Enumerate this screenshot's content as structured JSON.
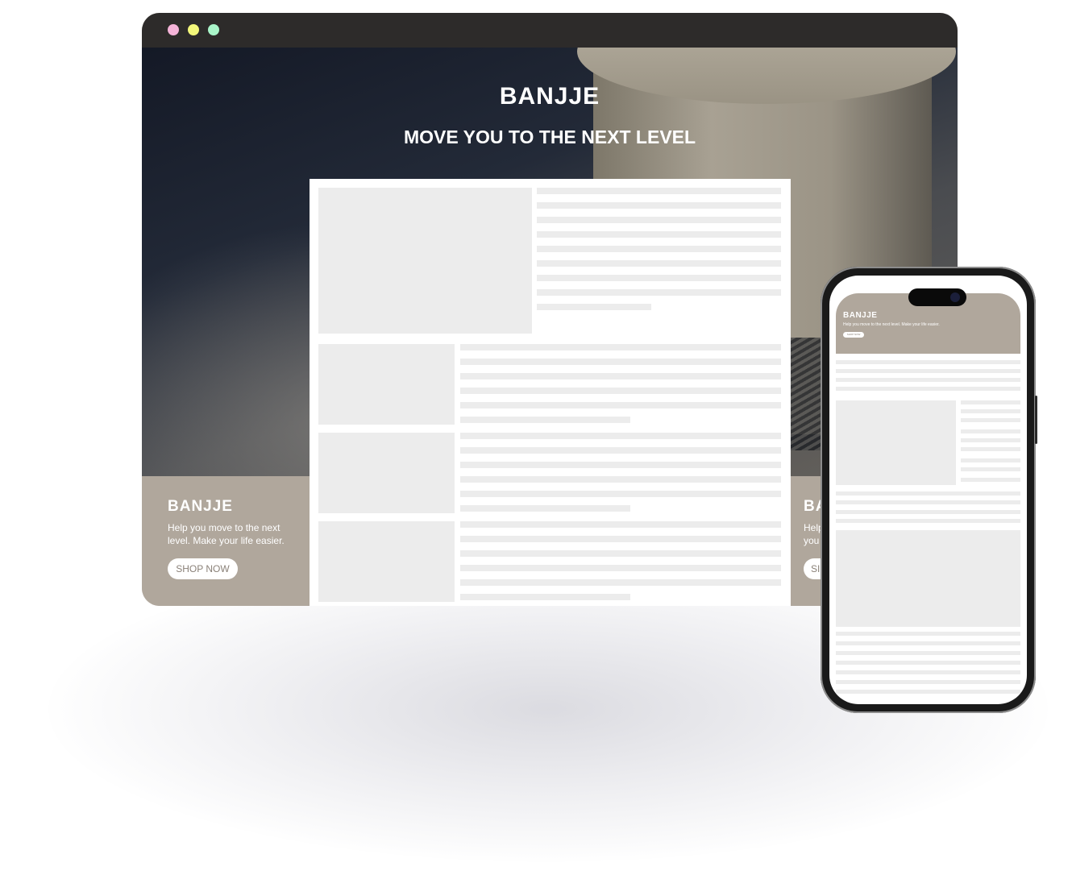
{
  "browser": {
    "window_controls": [
      {
        "name": "close",
        "color": "#f4b3d8"
      },
      {
        "name": "minimize",
        "color": "#f3f77a"
      },
      {
        "name": "maximize",
        "color": "#a9f5c9"
      }
    ]
  },
  "hero": {
    "brand": "BANJJE",
    "tagline": "MOVE YOU TO THE NEXT LEVEL"
  },
  "left_panel": {
    "brand": "BANJJE",
    "text_line1": "Help you move to the next",
    "text_line2": "level. Make your life easier.",
    "button": "SHOP NOW"
  },
  "right_panel": {
    "brand_partial": "BA",
    "text_line1_partial": "Help",
    "text_line2_partial": "you",
    "button_partial": "SI"
  },
  "phone": {
    "brand": "BANJJE",
    "text": "Help you move to the next level. Make your life easier.",
    "button": "SHOP NOW"
  },
  "colors": {
    "accent_panel": "#b0a79c",
    "titlebar": "#2d2b2a",
    "placeholder": "#ececec"
  }
}
